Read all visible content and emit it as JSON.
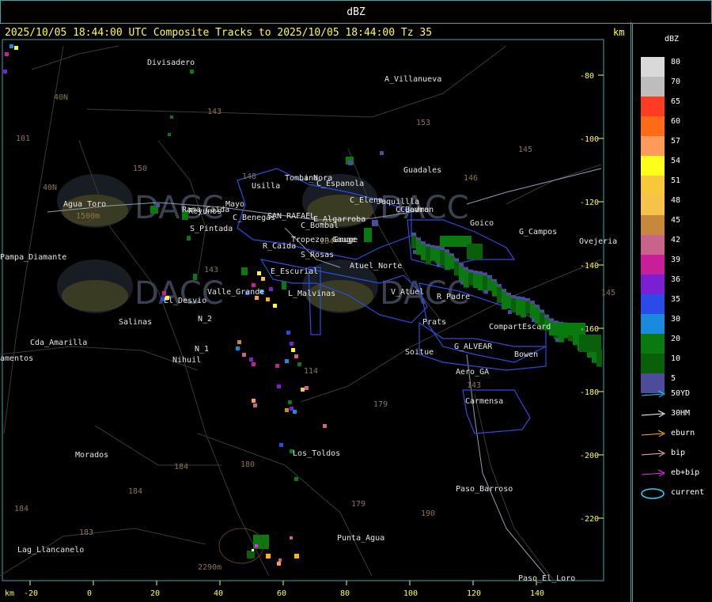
{
  "title_bar": "dBZ",
  "header": "2025/10/05 18:44:00 UTC Composite Tracks to 2025/10/05 18:44:00 Tz 35",
  "km_unit": "km",
  "legend": {
    "title": "dBZ",
    "scale": [
      {
        "value": "80",
        "color": "#d9d9d9"
      },
      {
        "value": "70",
        "color": "#bdbdbd"
      },
      {
        "value": "65",
        "color": "#ff3b24"
      },
      {
        "value": "60",
        "color": "#ff6a16"
      },
      {
        "value": "57",
        "color": "#ff9a5a"
      },
      {
        "value": "54",
        "color": "#ffff1a"
      },
      {
        "value": "51",
        "color": "#f7c83a"
      },
      {
        "value": "48",
        "color": "#f5c24a"
      },
      {
        "value": "45",
        "color": "#c8883c"
      },
      {
        "value": "42",
        "color": "#c8648c"
      },
      {
        "value": "39",
        "color": "#c81e9a"
      },
      {
        "value": "36",
        "color": "#7a1fd4"
      },
      {
        "value": "35",
        "color": "#2a4be8"
      },
      {
        "value": "30",
        "color": "#1a8adf"
      },
      {
        "value": "20",
        "color": "#0a7a10"
      },
      {
        "value": "10",
        "color": "#0a5f0a"
      },
      {
        "value": "5",
        "color": "#4c4c9a"
      }
    ],
    "tracks": [
      {
        "label": "50YD",
        "color": "#22d0ff"
      },
      {
        "label": "30HM",
        "color": "#ffffff"
      },
      {
        "label": "eburn",
        "color": "#ffb020"
      },
      {
        "label": "bip",
        "color": "#ffb0b0"
      },
      {
        "label": "eb+bip",
        "color": "#ff20ff"
      },
      {
        "label": "current",
        "color": "#22d0ff"
      }
    ]
  },
  "right_axis_ticks": [
    "-80",
    "-100",
    "-120",
    "-140",
    "-160",
    "-180",
    "-200",
    "-220"
  ],
  "bottom_axis_ticks": [
    "-20",
    "0",
    "20",
    "40",
    "60",
    "80",
    "100",
    "120",
    "140"
  ],
  "places": [
    {
      "name": "Divisadero"
    },
    {
      "name": "A_Villanueva"
    },
    {
      "name": "Guadales"
    },
    {
      "name": "Agua_Toro"
    },
    {
      "name": "Rama_Caida"
    },
    {
      "name": "S_Pintada"
    },
    {
      "name": "Pampa_Diamante"
    },
    {
      "name": "El_Desvio"
    },
    {
      "name": "Salinas"
    },
    {
      "name": "Cda_Amarilla"
    },
    {
      "name": "N_2"
    },
    {
      "name": "N_1"
    },
    {
      "name": "Nihuil"
    },
    {
      "name": "Valle_Grande"
    },
    {
      "name": "L_Malvinas"
    },
    {
      "name": "E_Escurial"
    },
    {
      "name": "S_Rosas"
    },
    {
      "name": "Atuel_Norte"
    },
    {
      "name": "V_Atuel"
    },
    {
      "name": "R_Padre"
    },
    {
      "name": "Prats"
    },
    {
      "name": "CompartEscard"
    },
    {
      "name": "G_ALVEAR"
    },
    {
      "name": "Bowen"
    },
    {
      "name": "Soitue"
    },
    {
      "name": "Aero_GA"
    },
    {
      "name": "Carmensa"
    },
    {
      "name": "Morados"
    },
    {
      "name": "Los_Toldos"
    },
    {
      "name": "Paso_Barroso"
    },
    {
      "name": "Punta_Agua"
    },
    {
      "name": "Lag_Llancanelo"
    },
    {
      "name": "Paso_El_Loro"
    },
    {
      "name": "Goico"
    },
    {
      "name": "G_Campos"
    },
    {
      "name": "Ovejeria"
    },
    {
      "name": "Usilla"
    },
    {
      "name": "La_Nora"
    },
    {
      "name": "C_Espanola"
    },
    {
      "name": "C_Benegas"
    },
    {
      "name": "SAN_RAFAEL"
    },
    {
      "name": "E_Algarroba"
    },
    {
      "name": "C_Bombal"
    },
    {
      "name": "Tropezon Gouge"
    },
    {
      "name": "R_Caida"
    },
    {
      "name": "Cuadro"
    },
    {
      "name": "Reyunos"
    },
    {
      "name": "Mayo"
    },
    {
      "name": "Tombina"
    },
    {
      "name": "C_Elena"
    },
    {
      "name": "Jaquillla"
    },
    {
      "name": "C_Bowman"
    },
    {
      "name": "amentos"
    },
    {
      "name": "Gouge"
    }
  ],
  "elevations": [
    "143",
    "153",
    "101",
    "40N",
    "150",
    "40N",
    "145",
    "146",
    "148",
    "143",
    "114",
    "179",
    "184",
    "180",
    "184",
    "179",
    "190",
    "184",
    "183",
    "143",
    "145",
    "184",
    "2290m",
    "1500m"
  ]
}
